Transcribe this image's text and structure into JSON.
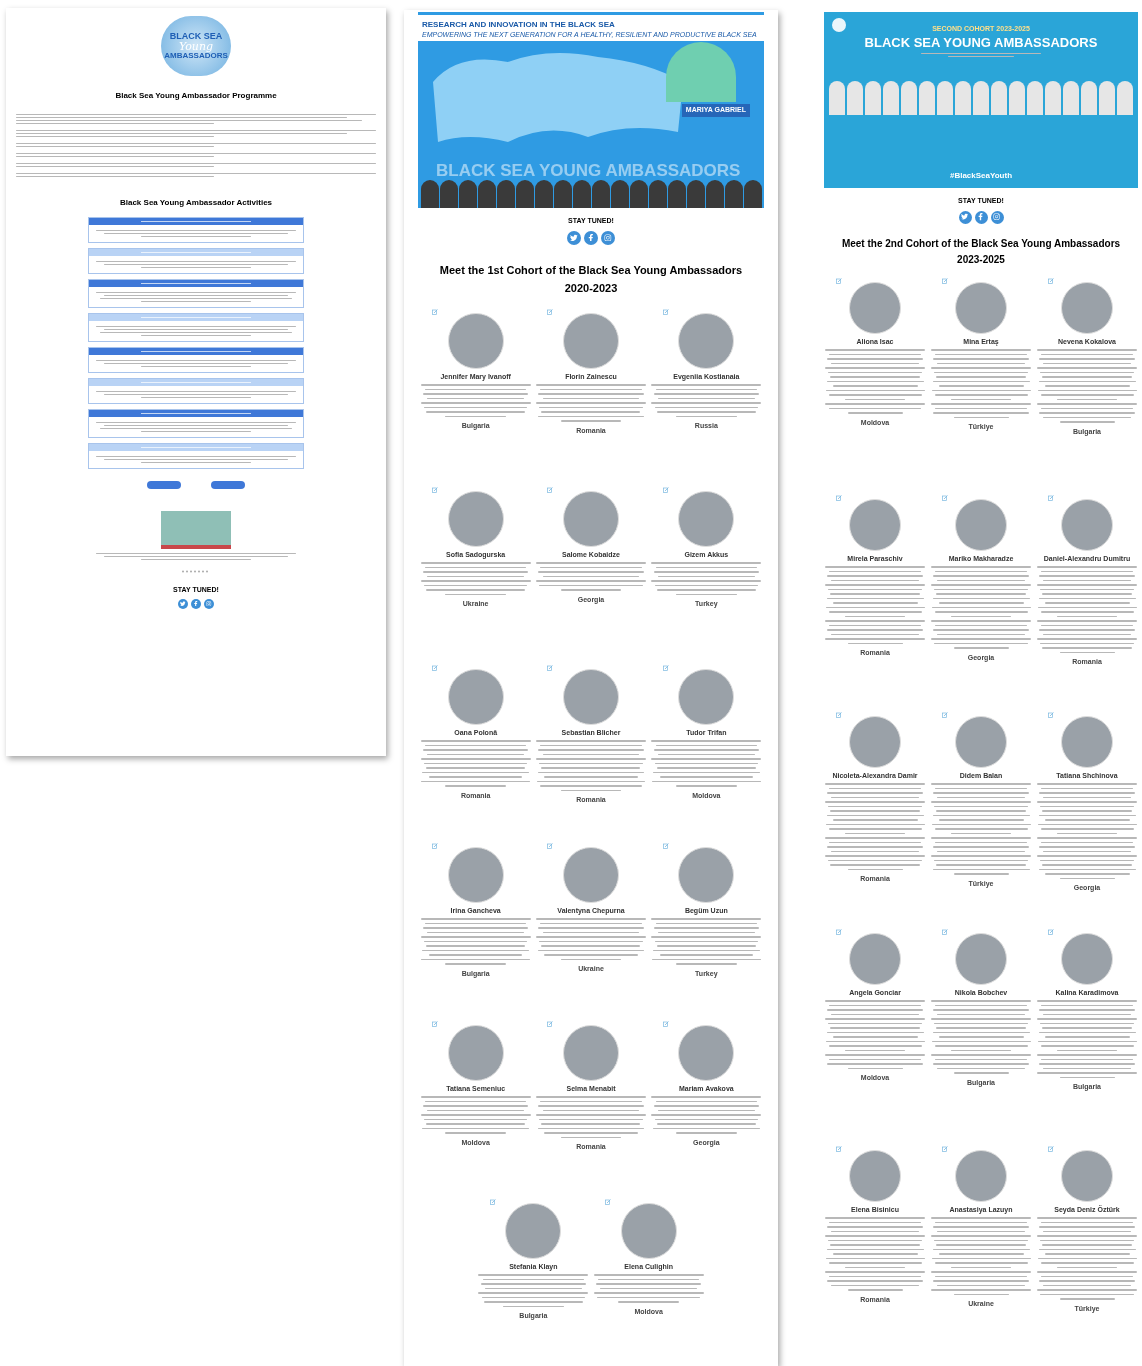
{
  "programme_page": {
    "logo": {
      "line_1": "BLACK SEA",
      "line_2": "Young",
      "line_3": "AMBASSADORS"
    },
    "title": "Black Sea Young Ambassador Programme",
    "activities_heading": "Black Sea Young Ambassador Activities",
    "activity_cards": [
      {
        "color": "#3f78d8"
      },
      {
        "color": "#b9d3f5"
      },
      {
        "color": "#3f78d8"
      },
      {
        "color": "#b9d3f5"
      },
      {
        "color": "#3f78d8"
      },
      {
        "color": "#b9d3f5"
      },
      {
        "color": "#3f78d8"
      },
      {
        "color": "#b9d3f5"
      }
    ],
    "stay_tuned": "STAY TUNED!"
  },
  "first_cohort_page": {
    "banner": {
      "title": "RESEARCH AND INNOVATION IN THE BLACK SEA",
      "subtitle": "EMPOWERING THE NEXT GENERATION FOR A HEALTHY, RESILIENT AND PRODUCTIVE BLACK SEA",
      "speaker": "MARIYA GABRIEL",
      "overlay": "BLACK SEA YOUNG AMBASSADORS"
    },
    "stay_tuned": "STAY TUNED!",
    "heading": "Meet the 1st Cohort of the Black Sea Young Ambassadors",
    "period": "2020-2023",
    "members": [
      {
        "name": "Jennifer Mary Ivanoff",
        "country": "Bulgaria"
      },
      {
        "name": "Florin Zainescu",
        "country": "Romania"
      },
      {
        "name": "Evgeniia Kostianaia",
        "country": "Russia"
      },
      {
        "name": "Sofia Sadogurska",
        "country": "Ukraine"
      },
      {
        "name": "Salome Kobaidze",
        "country": "Georgia"
      },
      {
        "name": "Gizem Akkus",
        "country": "Turkey"
      },
      {
        "name": "Oana Polonă",
        "country": "Romania"
      },
      {
        "name": "Sebastian Blicher",
        "country": "Romania"
      },
      {
        "name": "Tudor Trifan",
        "country": "Moldova"
      },
      {
        "name": "Irina Gancheva",
        "country": "Bulgaria"
      },
      {
        "name": "Valentyna Chepurna",
        "country": "Ukraine"
      },
      {
        "name": "Begüm Uzun",
        "country": "Turkey"
      },
      {
        "name": "Tatiana Semeniuc",
        "country": "Moldova"
      },
      {
        "name": "Selma Menabit",
        "country": "Romania"
      },
      {
        "name": "Mariam Avakova",
        "country": "Georgia"
      },
      {
        "name": "Stefania Klayn",
        "country": "Bulgaria"
      },
      {
        "name": "Elena Culighin",
        "country": "Moldova"
      }
    ]
  },
  "second_cohort_page": {
    "banner": {
      "kicker": "SECOND COHORT 2023-2025",
      "title": "BLACK SEA YOUNG AMBASSADORS",
      "hashtag": "#BlackSeaYouth"
    },
    "stay_tuned": "STAY TUNED!",
    "heading": "Meet the 2nd Cohort of the Black Sea Young Ambassadors",
    "period": "2023-2025",
    "members": [
      {
        "name": "Aliona Isac",
        "country": "Moldova"
      },
      {
        "name": "Mina Ertaş",
        "country": "Türkiye"
      },
      {
        "name": "Nevena Kokalova",
        "country": "Bulgaria"
      },
      {
        "name": "Mirela Paraschiv",
        "country": "Romania"
      },
      {
        "name": "Mariko Makharadze",
        "country": "Georgia"
      },
      {
        "name": "Daniel-Alexandru Dumitru",
        "country": "Romania"
      },
      {
        "name": "Nicoleta-Alexandra Damir",
        "country": "Romania"
      },
      {
        "name": "Didem Balan",
        "country": "Türkiye"
      },
      {
        "name": "Tatiana Shchinova",
        "country": "Georgia"
      },
      {
        "name": "Angela Gonciar",
        "country": "Moldova"
      },
      {
        "name": "Nikola Bobchev",
        "country": "Bulgaria"
      },
      {
        "name": "Kalina Karadimova",
        "country": "Bulgaria"
      },
      {
        "name": "Elena Bisinicu",
        "country": "Romania"
      },
      {
        "name": "Anastasiya Lazuyn",
        "country": "Ukraine"
      },
      {
        "name": "Seyda Deniz Öztürk",
        "country": "Türkiye"
      }
    ]
  }
}
